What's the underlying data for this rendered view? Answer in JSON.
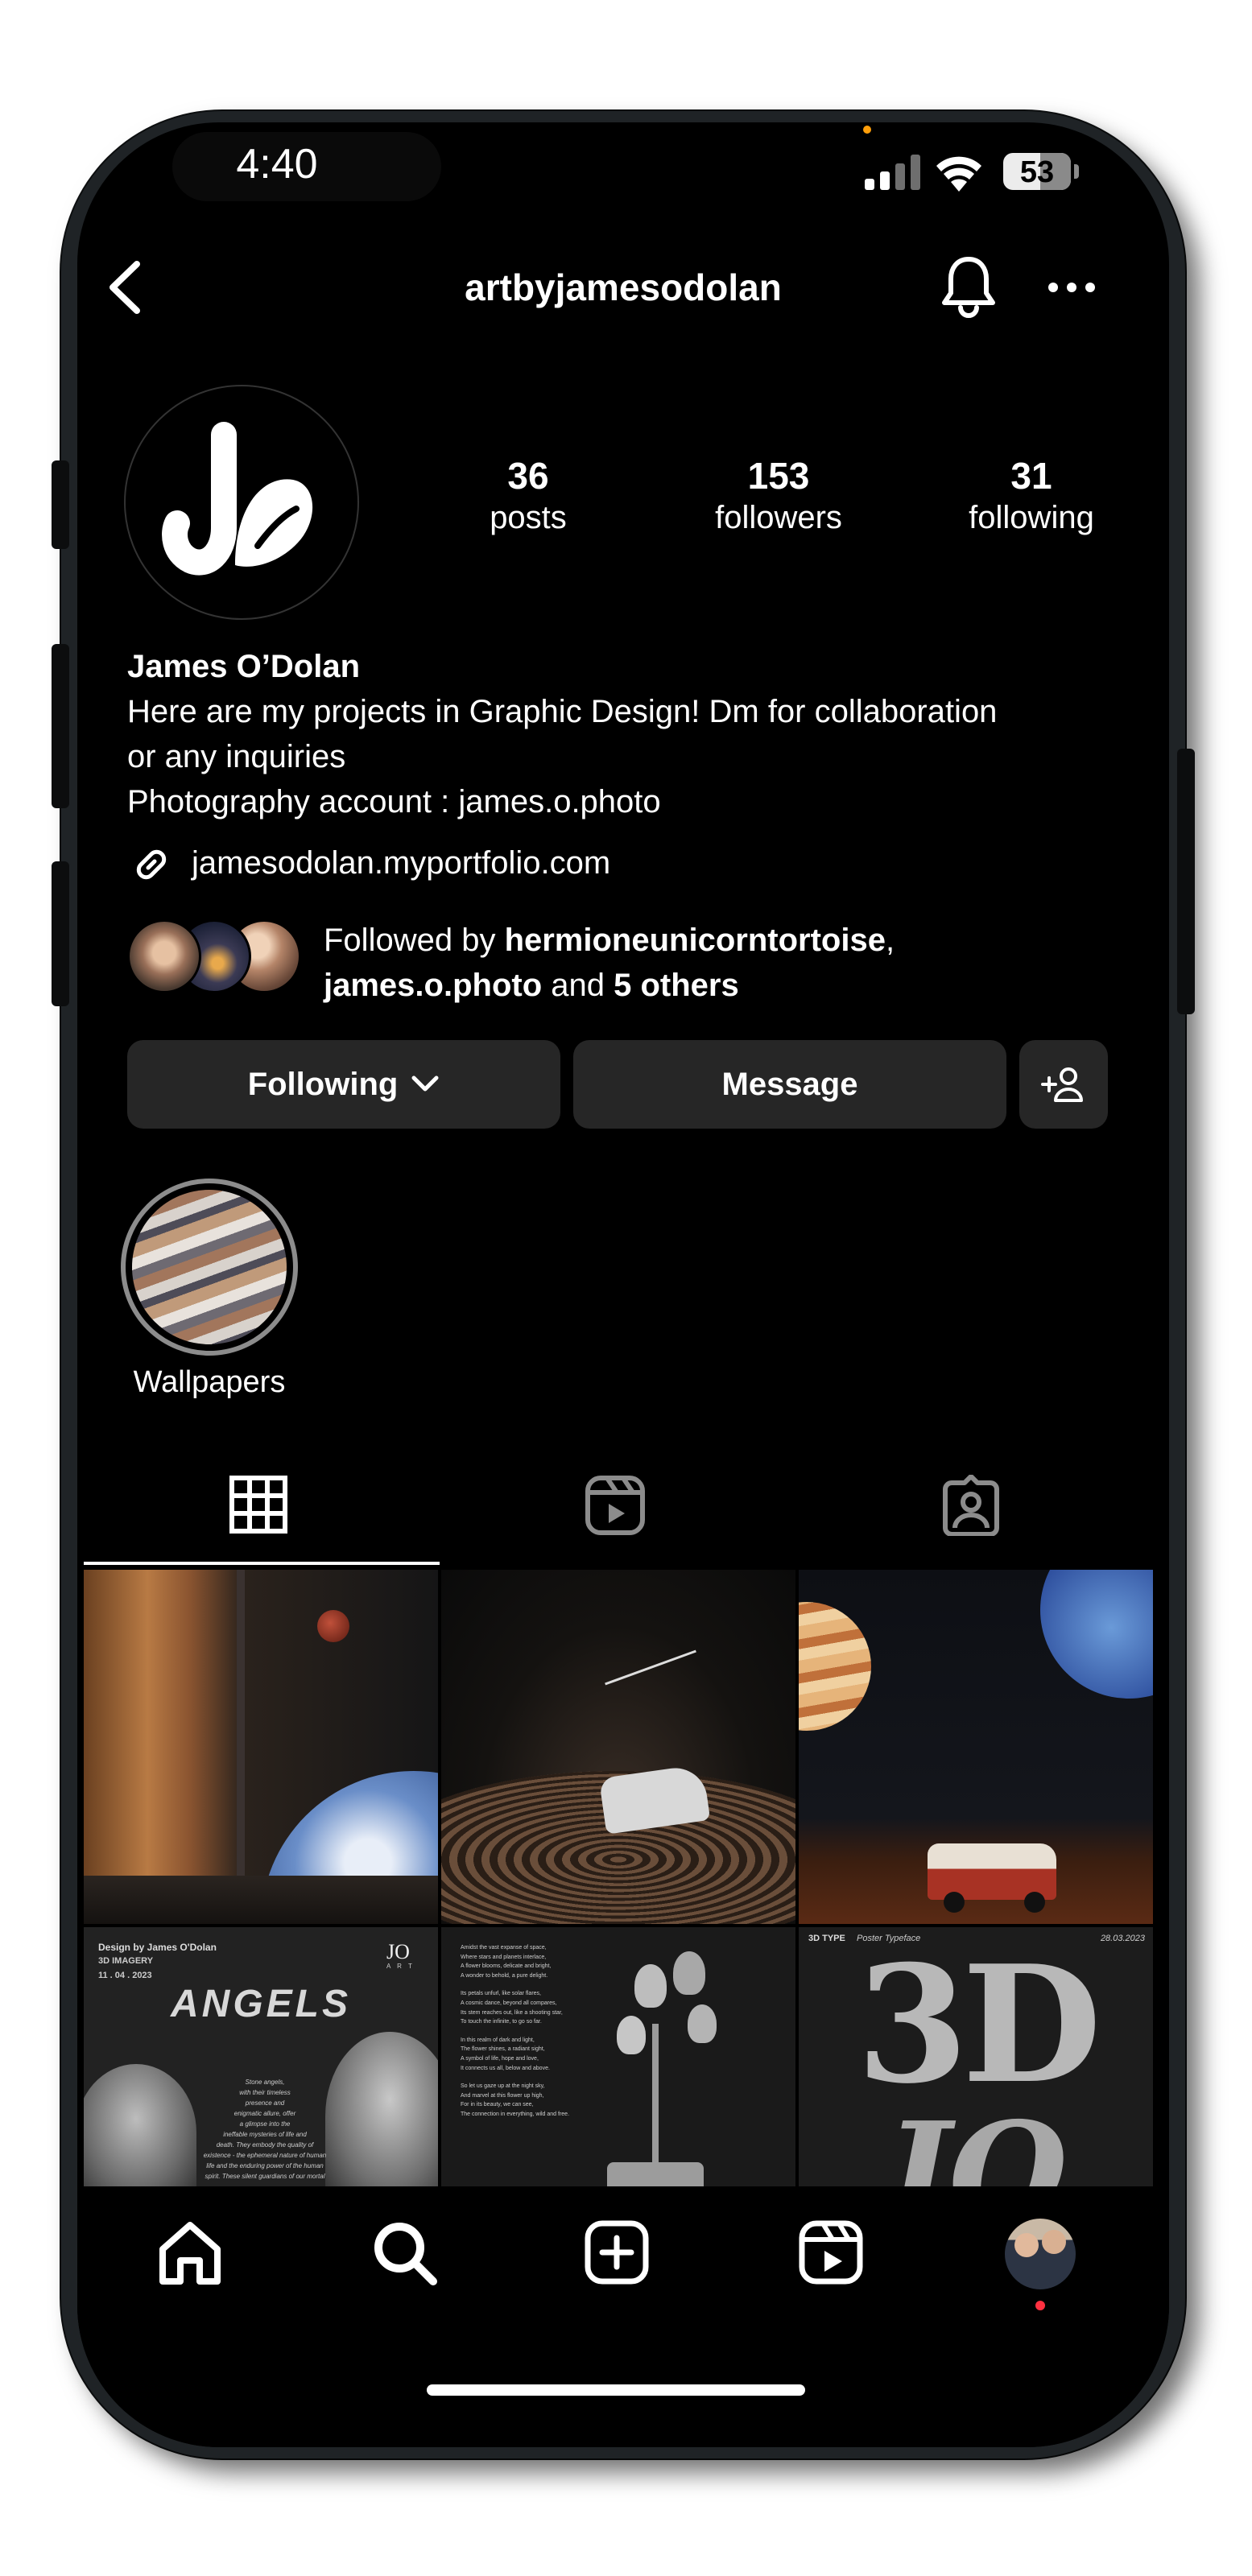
{
  "status_bar": {
    "time": "4:40",
    "battery": "53"
  },
  "header": {
    "username": "artbyjamesodolan"
  },
  "profile": {
    "avatar_text": "Jo",
    "stats": [
      {
        "value": "36",
        "label": "posts"
      },
      {
        "value": "153",
        "label": "followers"
      },
      {
        "value": "31",
        "label": "following"
      }
    ],
    "name": "James O’Dolan",
    "bio_line1": "Here are my projects in Graphic Design! Dm for collaboration",
    "bio_line2": "or any inquiries",
    "bio_line3": "Photography account : james.o.photo",
    "link": "jamesodolan.myportfolio.com",
    "followed_by": {
      "prefix": "Followed by ",
      "user1": "hermioneunicorntortoise",
      "sep": ",",
      "user2": "james.o.photo",
      "and": " and ",
      "others": "5 others"
    }
  },
  "buttons": {
    "following": "Following",
    "message": "Message"
  },
  "highlights": [
    {
      "label": "Wallpapers"
    }
  ],
  "tabs": [
    {
      "icon": "grid-icon",
      "active": true
    },
    {
      "icon": "reels-icon",
      "active": false
    },
    {
      "icon": "tagged-icon",
      "active": false
    }
  ],
  "posts": {
    "p4": {
      "header": "Design by James O'Dolan",
      "sub": "3D IMAGERY",
      "date": "11 . 04 . 2023",
      "logo": "JO",
      "logo_sub": "A R T",
      "title": "ANGELS",
      "body": [
        "Stone angels,",
        "with their timeless",
        "presence and",
        "enigmatic allure, offer",
        "a glimpse into the",
        "ineffable mysteries of life and",
        "death. They embody the quality of",
        "existence - the ephemeral nature of human",
        "life and the enduring power of the human",
        "spirit. These silent guardians of our mortal"
      ]
    },
    "p5": {
      "lines": [
        "Amidst the vast expanse of space,",
        "Where stars and planets interlace,",
        "A flower blooms, delicate and bright,",
        "A wonder to behold, a pure delight.",
        "",
        "Its petals unfurl, like solar flares,",
        "A cosmic dance, beyond all compares,",
        "Its stem reaches out, like a shooting star,",
        "To touch the infinite, to go so far.",
        "",
        "In this realm of dark and light,",
        "The flower shines, a radiant sight,",
        "A symbol of life, hope and love,",
        "It connects us all, below and above.",
        "",
        "So let us gaze up at the night sky,",
        "And marvel at this flower up high,",
        "For in its beauty, we can see,",
        "The connection in everything, wild and free."
      ]
    },
    "p6": {
      "tag": "3D TYPE",
      "sub": "Poster Typeface",
      "date": "28.03.2023",
      "big": "3D",
      "big2": "JO"
    }
  },
  "nav": [
    "home-icon",
    "search-icon",
    "create-icon",
    "reels-icon",
    "profile-icon"
  ]
}
